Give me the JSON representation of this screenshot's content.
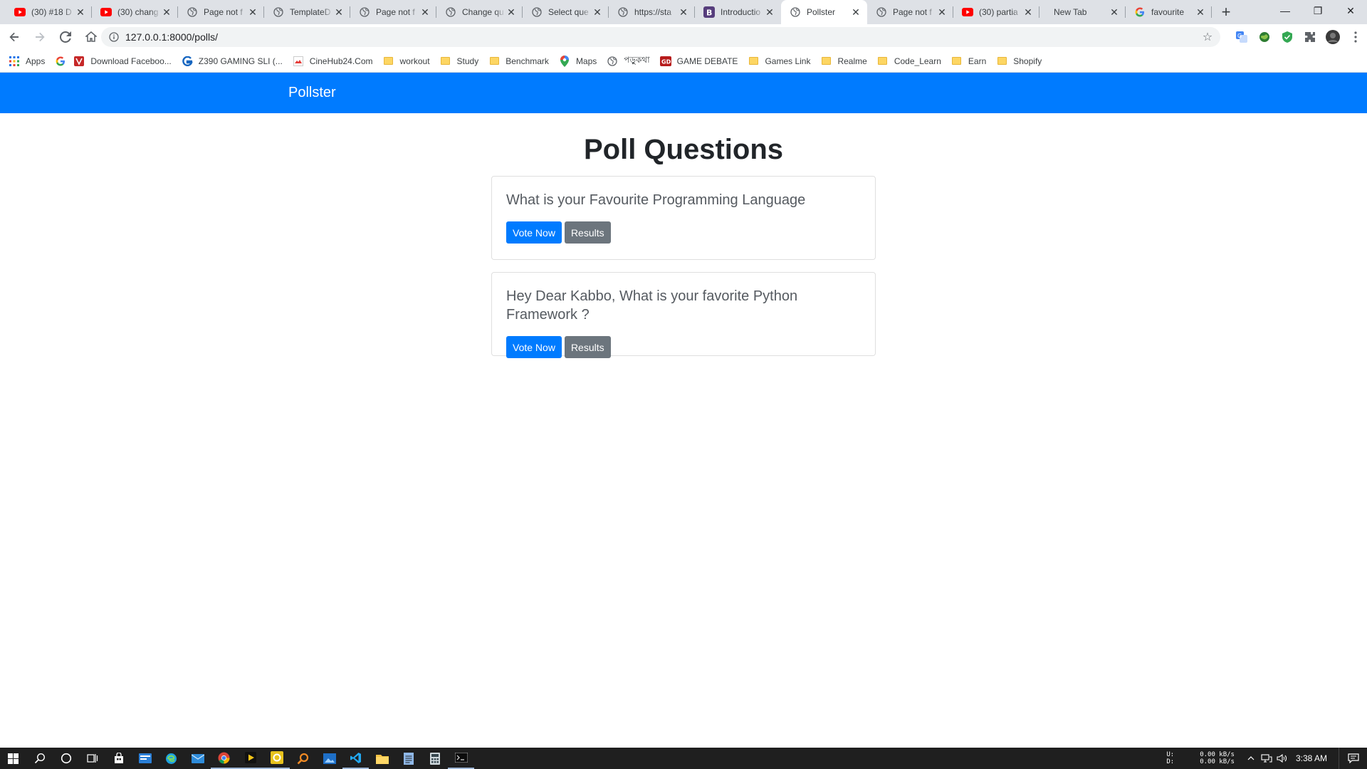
{
  "browser": {
    "tabs": [
      {
        "title": "(30) #18 D",
        "favicon": "youtube-icon",
        "active": false
      },
      {
        "title": "(30) chang",
        "favicon": "youtube-icon",
        "active": false
      },
      {
        "title": "Page not f",
        "favicon": "globe-icon",
        "active": false
      },
      {
        "title": "TemplateD",
        "favicon": "globe-icon",
        "active": false
      },
      {
        "title": "Page not f",
        "favicon": "globe-icon",
        "active": false
      },
      {
        "title": "Change qu",
        "favicon": "globe-icon",
        "active": false
      },
      {
        "title": "Select que",
        "favicon": "globe-icon",
        "active": false
      },
      {
        "title": "https://sta",
        "favicon": "globe-icon",
        "active": false
      },
      {
        "title": "Introductio",
        "favicon": "bootstrap-icon",
        "active": false
      },
      {
        "title": "Pollster",
        "favicon": "globe-icon",
        "active": true
      },
      {
        "title": "Page not f",
        "favicon": "globe-icon",
        "active": false
      },
      {
        "title": "(30) partia",
        "favicon": "youtube-icon",
        "active": false
      },
      {
        "title": "New Tab",
        "favicon": "",
        "active": false
      },
      {
        "title": "favourite",
        "favicon": "google-icon",
        "active": false
      }
    ],
    "url": "127.0.0.1:8000/polls/",
    "bookmarks": [
      {
        "label": "Apps",
        "icon": "apps-grid-icon"
      },
      {
        "label": "",
        "icon": "google-icon"
      },
      {
        "label": "Download Faceboo...",
        "icon": "download-site-icon"
      },
      {
        "label": "Z390 GAMING SLI (...",
        "icon": "gigabyte-icon"
      },
      {
        "label": "CineHub24.Com",
        "icon": "cinehub-icon"
      },
      {
        "label": "workout",
        "icon": "folder-icon"
      },
      {
        "label": "Study",
        "icon": "folder-icon"
      },
      {
        "label": "Benchmark",
        "icon": "folder-icon"
      },
      {
        "label": "Maps",
        "icon": "maps-pin-icon"
      },
      {
        "label": "পড়ুকথা",
        "icon": "globe-icon"
      },
      {
        "label": "GAME DEBATE",
        "icon": "gamedebate-icon"
      },
      {
        "label": "Games Link",
        "icon": "folder-icon"
      },
      {
        "label": "Realme",
        "icon": "folder-icon"
      },
      {
        "label": "Code_Learn",
        "icon": "folder-icon"
      },
      {
        "label": "Earn",
        "icon": "folder-icon"
      },
      {
        "label": "Shopify",
        "icon": "folder-icon"
      }
    ]
  },
  "app": {
    "brand": "Pollster",
    "heading": "Poll Questions",
    "polls": [
      {
        "question": "What is your Favourite Programming Language",
        "vote_label": "Vote Now",
        "results_label": "Results"
      },
      {
        "question": "Hey Dear Kabbo, What is your favorite Python Framework ?",
        "vote_label": "Vote Now",
        "results_label": "Results"
      }
    ]
  },
  "taskbar": {
    "net_labels": [
      "U:",
      "D:"
    ],
    "net_values": [
      "0.00 kB/s",
      "0.00 kB/s"
    ],
    "time": "3:38 AM"
  },
  "colors": {
    "brand_blue": "#007bff",
    "secondary_gray": "#6c757d",
    "taskbar": "#1f1f1f"
  }
}
